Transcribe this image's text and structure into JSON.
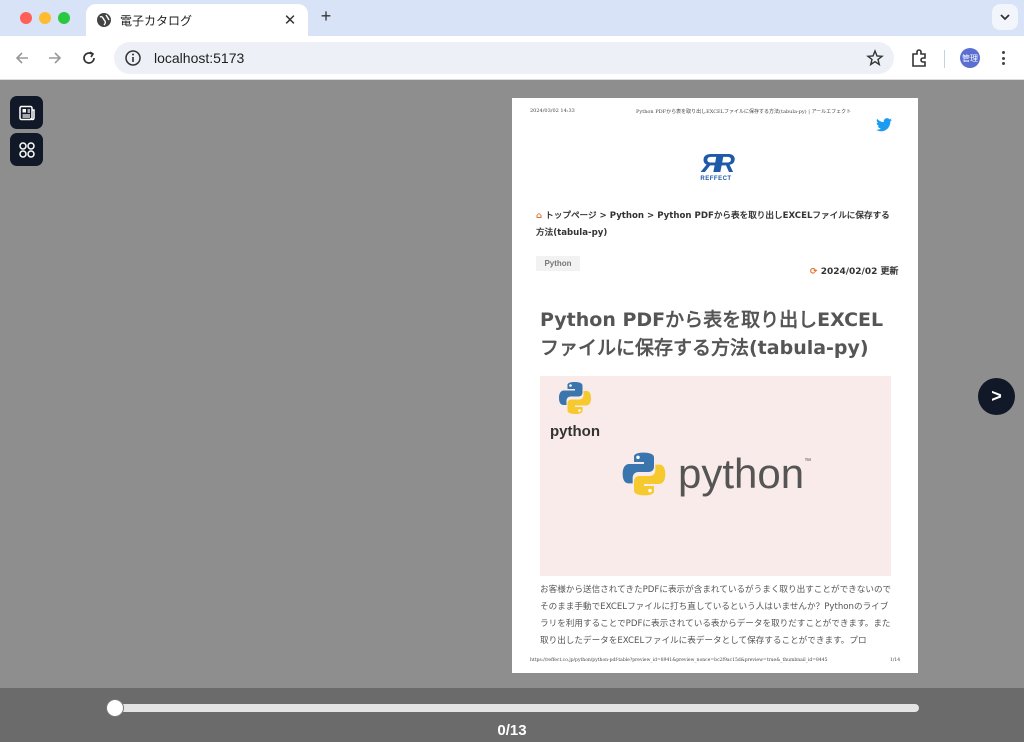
{
  "browser": {
    "tab_title": "電子カタログ",
    "url": "localhost:5173",
    "profile_label": "管理",
    "accent_color": "#d8e3f7"
  },
  "viewer": {
    "next_label": ">",
    "progress": {
      "current": 0,
      "total": 13,
      "label": "0/13",
      "fraction": 0.0
    },
    "page": {
      "print_date": "2024/03/02 14:33",
      "print_header": "Python PDFから表を取り出しEXCELファイルに保存する方法(tabula-py) | アールエフェクト",
      "logo_text": "REFFECT",
      "breadcrumb": "トップページ > Python > Python PDFから表を取り出しEXCELファイルに保存する方法(tabula-py)",
      "category": "Python",
      "updated": "2024/02/02 更新",
      "title": "Python PDFから表を取り出しEXCELファイルに保存する方法(tabula-py)",
      "hero_small_word": "python",
      "hero_big_word": "python",
      "hero_tm": "™",
      "body_text": "お客様から送信されてきたPDFに表示が含まれているがうまく取り出すことができないのでそのまま手動でEXCELファイルに打ち直しているという人はいませんか？Pythonのライブラリを利用することでPDFに表示されている表からデータを取りだすことができます。また取り出したデータをEXCELファイルに表データとして保存することができます。プロ",
      "footer_url": "https://reffect.co.jp/python/python-pdf-table?preview_id=8941&preview_nonce=bc2f9ac15d&preview=true&_thumbnail_id=8445",
      "page_number": "1/14"
    }
  }
}
